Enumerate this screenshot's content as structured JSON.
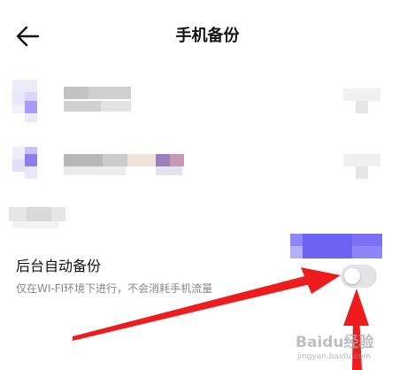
{
  "header": {
    "title": "手机备份",
    "back_icon": "arrow-left-icon"
  },
  "auto_backup": {
    "title": "后台自动备份",
    "description": "仅在WI-FI环境下进行，不会消耗手机流量",
    "enabled": false
  },
  "watermark": {
    "logo": "Baidu经验",
    "url": "jingyan.baidu.com"
  },
  "colors": {
    "annotation_arrow": "#ee1c1c",
    "toggle_off": "#e3e3e6",
    "blur_accent": "#6b5cf0"
  }
}
